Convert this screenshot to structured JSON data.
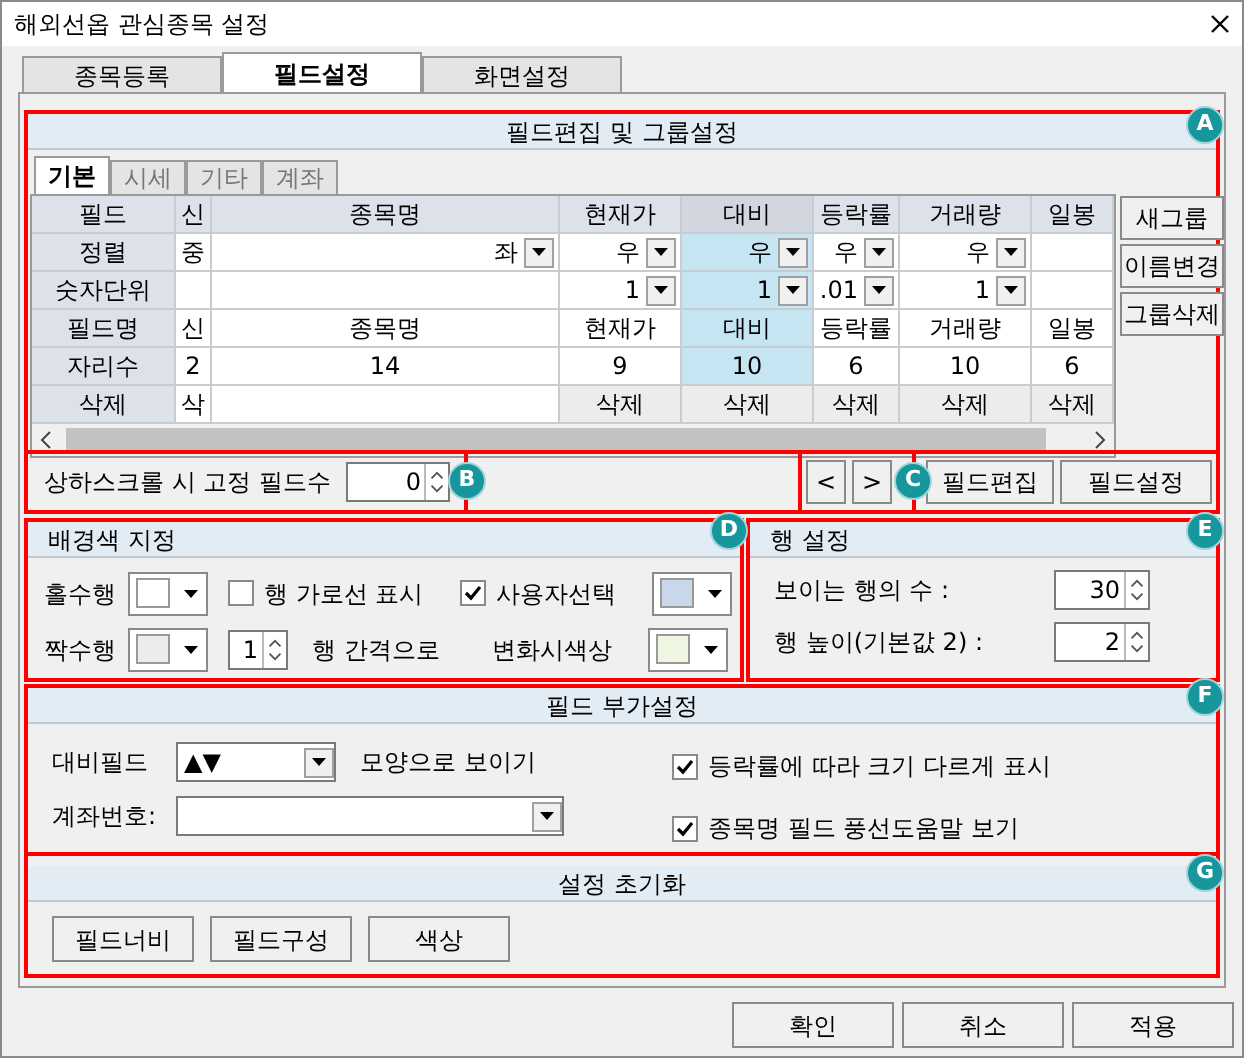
{
  "window": {
    "title": "해외선옵 관심종목 설정"
  },
  "tabs": [
    {
      "label": "종목등록",
      "selected": false
    },
    {
      "label": "필드설정",
      "selected": true
    },
    {
      "label": "화면설정",
      "selected": false
    }
  ],
  "field_edit": {
    "badge": "A",
    "title": "필드편집 및 그룹설정",
    "tabs": [
      {
        "label": "기본",
        "selected": true
      },
      {
        "label": "시세",
        "selected": false
      },
      {
        "label": "기타",
        "selected": false
      },
      {
        "label": "계좌",
        "selected": false
      }
    ],
    "grid": {
      "corner": "필드",
      "columns": [
        {
          "header": "신",
          "selected": false
        },
        {
          "header": "종목명",
          "selected": false
        },
        {
          "header": "현재가",
          "selected": false
        },
        {
          "header": "대비",
          "selected": true
        },
        {
          "header": "등락률",
          "selected": false
        },
        {
          "header": "거래량",
          "selected": false
        },
        {
          "header": "일봉",
          "selected": false
        }
      ],
      "rows": [
        {
          "label": "정렬",
          "cells": [
            {
              "kind": "text",
              "text": "중"
            },
            {
              "kind": "dropdown",
              "text": "좌"
            },
            {
              "kind": "dropdown",
              "text": "우"
            },
            {
              "kind": "dropdown",
              "text": "우"
            },
            {
              "kind": "dropdown",
              "text": "우"
            },
            {
              "kind": "dropdown",
              "text": "우"
            },
            {
              "kind": "empty"
            }
          ]
        },
        {
          "label": "숫자단위",
          "cells": [
            {
              "kind": "empty"
            },
            {
              "kind": "empty"
            },
            {
              "kind": "dropdown",
              "text": "1"
            },
            {
              "kind": "dropdown",
              "text": "1"
            },
            {
              "kind": "dropdown",
              "text": ".01"
            },
            {
              "kind": "dropdown",
              "text": "1"
            },
            {
              "kind": "empty"
            }
          ]
        },
        {
          "label": "필드명",
          "cells": [
            {
              "kind": "text",
              "text": "신"
            },
            {
              "kind": "text",
              "text": "종목명"
            },
            {
              "kind": "text",
              "text": "현재가"
            },
            {
              "kind": "text",
              "text": "대비"
            },
            {
              "kind": "text",
              "text": "등락률"
            },
            {
              "kind": "text",
              "text": "거래량"
            },
            {
              "kind": "text",
              "text": "일봉"
            }
          ]
        },
        {
          "label": "자리수",
          "cells": [
            {
              "kind": "text",
              "text": "2"
            },
            {
              "kind": "text",
              "text": "14"
            },
            {
              "kind": "text",
              "text": "9"
            },
            {
              "kind": "text",
              "text": "10"
            },
            {
              "kind": "text",
              "text": "6"
            },
            {
              "kind": "text",
              "text": "10"
            },
            {
              "kind": "text",
              "text": "6"
            }
          ]
        },
        {
          "label": "삭제",
          "cells": [
            {
              "kind": "text",
              "text": "삭"
            },
            {
              "kind": "empty"
            },
            {
              "kind": "button",
              "text": "삭제"
            },
            {
              "kind": "button",
              "text": "삭제"
            },
            {
              "kind": "button",
              "text": "삭제"
            },
            {
              "kind": "button",
              "text": "삭제"
            },
            {
              "kind": "button",
              "text": "삭제"
            }
          ]
        }
      ]
    },
    "group_buttons": [
      "새그룹",
      "이름변경",
      "그룹삭제"
    ]
  },
  "fixed_fields": {
    "badge": "B",
    "label": "상하스크롤 시 고정 필드수",
    "value": "0"
  },
  "field_nav": {
    "badge": "C",
    "buttons": [
      "<",
      ">"
    ]
  },
  "field_buttons": [
    "필드편집",
    "필드설정"
  ],
  "background": {
    "badge": "D",
    "title": "배경색 지정",
    "odd_row": {
      "label": "홀수행",
      "color": "#ffffff"
    },
    "even_row": {
      "label": "짝수행",
      "color": "#ececec"
    },
    "row_lines": {
      "label": "행 가로선 표시",
      "checked": false
    },
    "custom": {
      "label": "사용자선택",
      "checked": true,
      "color": "#c8d8ea"
    },
    "interval": {
      "value": "1",
      "label": "행 간격으로"
    },
    "change_color": {
      "label": "변화시색상",
      "color": "#eef6e2"
    }
  },
  "row_settings": {
    "badge": "E",
    "title": "행 설정",
    "fields": [
      {
        "label": "보이는 행의 수 :",
        "value": "30"
      },
      {
        "label": "행 높이(기본값 2) :",
        "value": "2"
      }
    ]
  },
  "field_extras": {
    "badge": "F",
    "title": "필드 부가설정",
    "compare_field": {
      "label": "대비필드",
      "value": "▲▼",
      "suffix": "모양으로 보이기"
    },
    "account": {
      "label": "계좌번호:"
    },
    "options": [
      {
        "label": "등락률에 따라 크기 다르게 표시",
        "checked": true
      },
      {
        "label": "종목명 필드 풍선도움말 보기",
        "checked": true
      }
    ]
  },
  "reset": {
    "badge": "G",
    "title": "설정 초기화",
    "buttons": [
      "필드너비",
      "필드구성",
      "색상"
    ]
  },
  "buttons": [
    "확인",
    "취소",
    "적용"
  ]
}
